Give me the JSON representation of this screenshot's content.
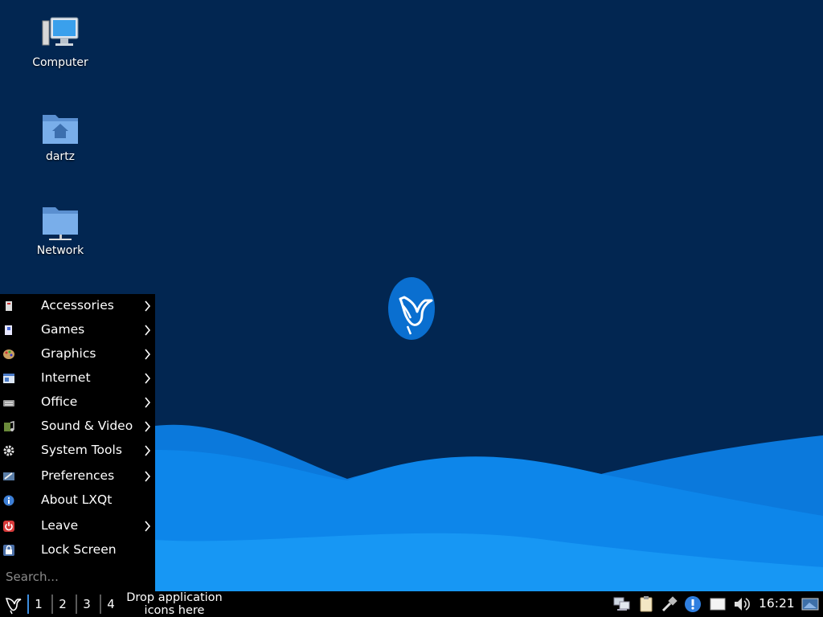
{
  "desktop": {
    "icons": [
      {
        "label": "Computer",
        "icon": "computer-icon"
      },
      {
        "label": "dartz",
        "icon": "home-folder-icon"
      },
      {
        "label": "Network",
        "icon": "network-folder-icon"
      }
    ]
  },
  "menu": {
    "items": [
      {
        "label": "Accessories",
        "icon": "accessories-icon",
        "submenu": true
      },
      {
        "label": "Games",
        "icon": "games-icon",
        "submenu": true
      },
      {
        "label": "Graphics",
        "icon": "graphics-icon",
        "submenu": true
      },
      {
        "label": "Internet",
        "icon": "internet-icon",
        "submenu": true
      },
      {
        "label": "Office",
        "icon": "office-icon",
        "submenu": true
      },
      {
        "label": "Sound & Video",
        "icon": "sound-video-icon",
        "submenu": true
      },
      {
        "label": "System Tools",
        "icon": "gear-icon",
        "submenu": true
      },
      {
        "label": "Preferences",
        "icon": "preferences-icon",
        "submenu": true
      },
      {
        "label": "About LXQt",
        "icon": "info-icon",
        "submenu": false
      },
      {
        "label": "Leave",
        "icon": "power-icon",
        "submenu": true
      },
      {
        "label": "Lock Screen",
        "icon": "lock-icon",
        "submenu": false
      }
    ],
    "search_placeholder": "Search..."
  },
  "taskbar": {
    "desktops": [
      "1",
      "2",
      "3",
      "4"
    ],
    "active_desktop": "1",
    "quicklaunch_line1": "Drop application",
    "quicklaunch_line2": "icons here",
    "tray_icons": [
      "network-status-icon",
      "clipboard-icon",
      "usb-mount-icon",
      "update-notification-icon",
      "battery-icon",
      "volume-icon"
    ],
    "clock": "16:21",
    "show_desktop_icon": "show-desktop-icon"
  },
  "colors": {
    "desktop_bg": "#022651",
    "wave_light": "#0c8ff0",
    "wave_mid": "#0a7ae0",
    "taskbar_bg": "#000000",
    "accent": "#3d8ee0"
  }
}
